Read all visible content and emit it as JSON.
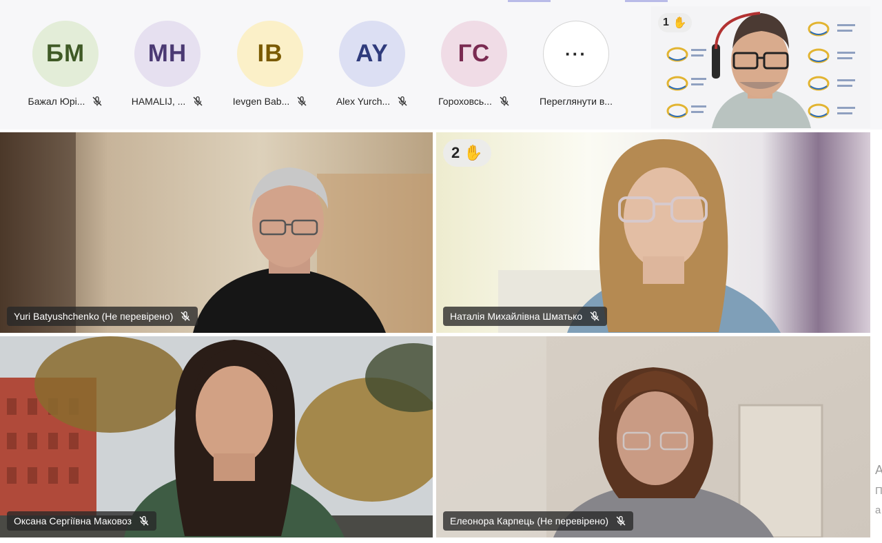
{
  "participants_strip": [
    {
      "initials": "БМ",
      "name": "Бажал Юрі...",
      "bg": "#e3edd8",
      "fg": "#3f5a26"
    },
    {
      "initials": "МН",
      "name": "HAMALIJ, ...",
      "bg": "#e6e0f0",
      "fg": "#4b3a73"
    },
    {
      "initials": "ІВ",
      "name": "Ievgen Bab...",
      "bg": "#fbf0c8",
      "fg": "#7a5a00"
    },
    {
      "initials": "AY",
      "name": "Alex Yurch...",
      "bg": "#dcdff3",
      "fg": "#2f3b7c"
    },
    {
      "initials": "ГС",
      "name": "Гороховсь...",
      "bg": "#f0dce6",
      "fg": "#7a2b52"
    }
  ],
  "more": {
    "label": "Переглянути в...",
    "symbol": "···"
  },
  "presenter": {
    "hand_count": "1",
    "hand_icon": "✋"
  },
  "tiles": [
    {
      "name": "Yuri Batyushchenko (Не перевірено)"
    },
    {
      "name": "Наталія Михайлівна Шматько",
      "hand_count": "2",
      "hand_icon": "✋"
    },
    {
      "name": "Оксана Сергіївна Маковоз"
    },
    {
      "name": "Елеонора Карпець (Не перевірено)"
    }
  ],
  "side_fragments": [
    "А",
    "П",
    "а"
  ],
  "colors": {
    "highlight": "#e3a21a",
    "accent": "#b9bbe8"
  }
}
